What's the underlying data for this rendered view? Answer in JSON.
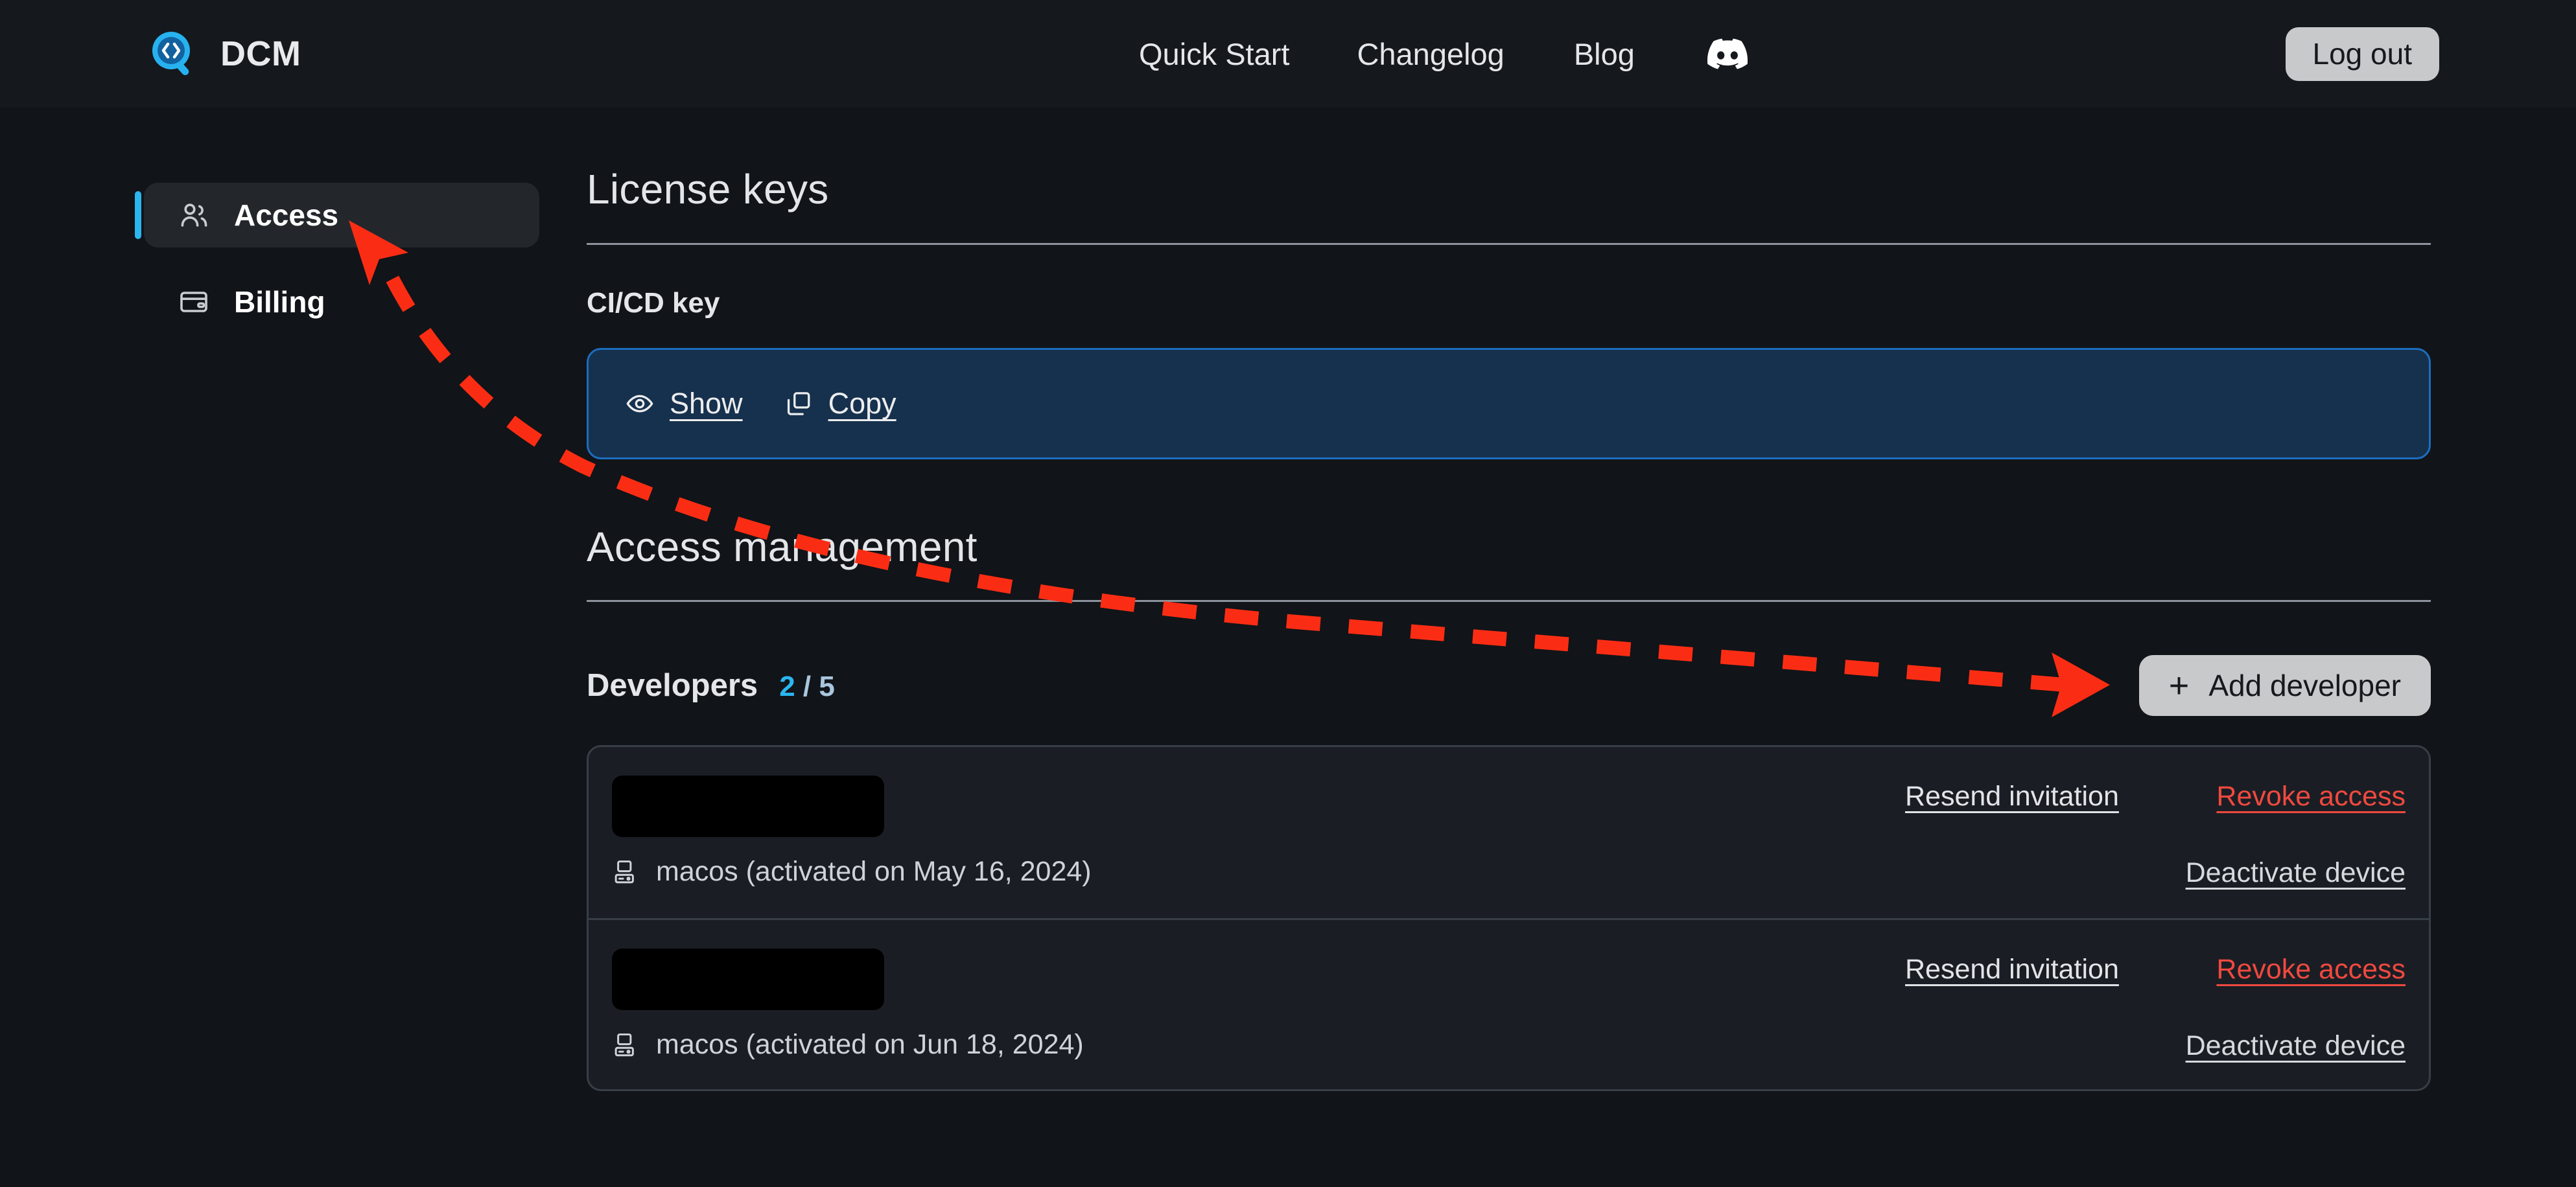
{
  "header": {
    "brand": {
      "name": "DCM",
      "logo_icon": "magnifier-code-logo",
      "accent": "#1f7fd0"
    },
    "nav": [
      {
        "label": "Quick Start",
        "icon": ""
      },
      {
        "label": "Changelog",
        "icon": ""
      },
      {
        "label": "Blog",
        "icon": ""
      },
      {
        "label": "",
        "icon": "discord-icon"
      }
    ],
    "logout_label": "Log out"
  },
  "sidebar": {
    "items": [
      {
        "label": "Access",
        "icon": "users-icon",
        "active": true
      },
      {
        "label": "Billing",
        "icon": "credit-card-icon",
        "active": false
      }
    ],
    "active_accent": "#2bb6f0"
  },
  "main": {
    "license_keys": {
      "title": "License keys",
      "cicd_label": "CI/CD key",
      "panel": {
        "show_label": "Show",
        "show_icon": "eye-icon",
        "copy_label": "Copy",
        "copy_icon": "copy-icon",
        "bg": "#16314d",
        "border": "#1d6dbf"
      }
    },
    "access_management": {
      "title": "Access management",
      "developers": {
        "title": "Developers",
        "count_current": "2",
        "count_separator": "/",
        "count_max": "5",
        "add_button_label": "Add developer",
        "add_button_icon": "plus-icon",
        "rows": [
          {
            "email_redacted": true,
            "device_icon": "computer-icon",
            "device_text": "macos (activated on May 16, 2024)",
            "resend_label": "Resend invitation",
            "revoke_label": "Revoke access",
            "deactivate_label": "Deactivate device"
          },
          {
            "email_redacted": true,
            "device_icon": "computer-icon",
            "device_text": "macos (activated on Jun 18, 2024)",
            "resend_label": "Resend invitation",
            "revoke_label": "Revoke access",
            "deactivate_label": "Deactivate device"
          }
        ]
      }
    }
  },
  "annotation": {
    "color": "#fa2d14",
    "style": "dashed-curved-double-arrow",
    "from": "add-developer-button",
    "to": "sidebar-item-access"
  }
}
